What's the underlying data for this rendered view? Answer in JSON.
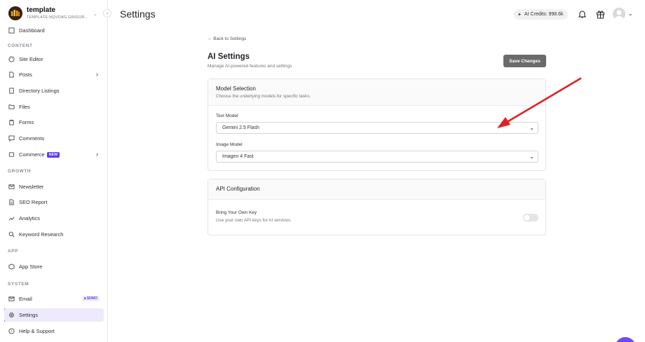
{
  "sidebar": {
    "brand_title": "template",
    "brand_subtitle": "TEMPLATE-NQVDAG.GRIGOR...",
    "sections": {
      "content": "CONTENT",
      "growth": "GROWTH",
      "app": "APP",
      "system": "SYSTEM"
    },
    "items": {
      "dashboard": "Dashboard",
      "site_editor": "Site Editor",
      "posts": "Posts",
      "directory": "Directory Listings",
      "files": "Files",
      "forms": "Forms",
      "comments": "Comments",
      "commerce": "Commerce",
      "commerce_badge": "NEW",
      "newsletter": "Newsletter",
      "seo": "SEO Report",
      "analytics": "Analytics",
      "keyword": "Keyword Research",
      "app_store": "App Store",
      "email": "Email",
      "email_badge": "$5/MO",
      "settings": "Settings",
      "help": "Help & Support"
    }
  },
  "header": {
    "title": "Settings",
    "credits": "AI Credits: 998.6k"
  },
  "main": {
    "back_link": "← Back to Settings",
    "title": "AI Settings",
    "subtitle": "Manage AI-powered features and settings",
    "save_button": "Save Changes",
    "model_selection": {
      "title": "Model Selection",
      "description": "Choose the underlying models for specific tasks.",
      "text_model_label": "Text Model",
      "text_model_value": "Gemini 2.5 Flash",
      "image_model_label": "Image Model",
      "image_model_value": "Imagen 4 Fast"
    },
    "api_config": {
      "title": "API Configuration",
      "byok_label": "Bring Your Own Key",
      "byok_desc": "Use your own API keys for AI services.",
      "byok_enabled": false
    }
  },
  "colors": {
    "accent": "#6d4aff",
    "annotation_arrow": "#e02020",
    "save_button_bg": "#6b6b6b"
  }
}
